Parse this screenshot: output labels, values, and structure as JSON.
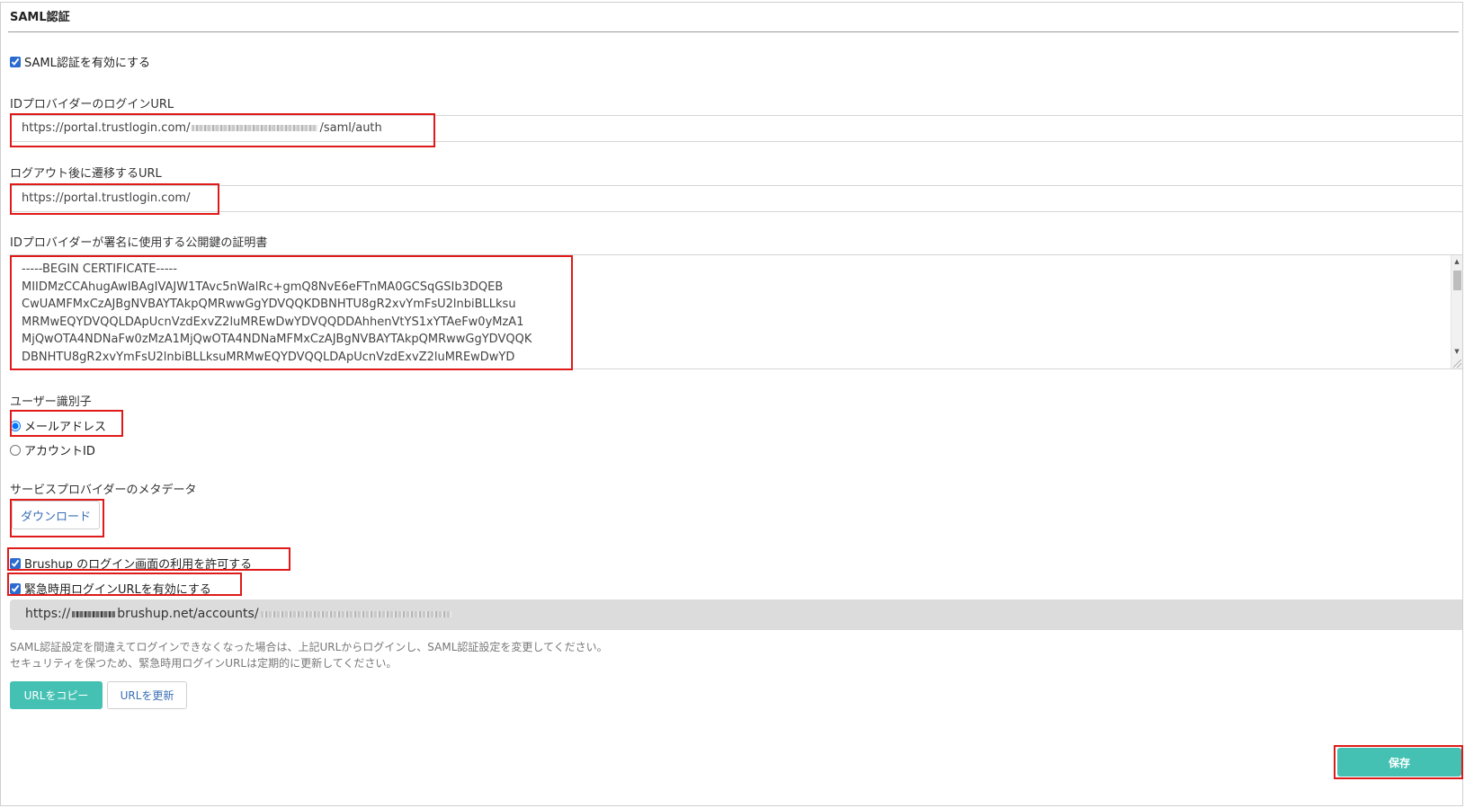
{
  "section": {
    "title": "SAML認証"
  },
  "enable_saml": {
    "label": "SAML認証を有効にする",
    "checked": true
  },
  "idp_login_url": {
    "label": "IDプロバイダーのログインURL",
    "value_prefix": "https://portal.trustlogin.com/",
    "value_suffix": "/saml/auth"
  },
  "logout_url": {
    "label": "ログアウト後に遷移するURL",
    "value": "https://portal.trustlogin.com/"
  },
  "certificate": {
    "label": "IDプロバイダーが署名に使用する公開鍵の証明書",
    "lines": [
      "-----BEGIN CERTIFICATE-----",
      "MIIDMzCCAhugAwIBAgIVAJW1TAvc5nWalRc+gmQ8NvE6eFTnMA0GCSqGSIb3DQEB",
      "CwUAMFMxCzAJBgNVBAYTAkpQMRwwGgYDVQQKDBNHTU8gR2xvYmFsU2lnbiBLLksu",
      "MRMwEQYDVQQLDApUcnVzdExvZ2luMREwDwYDVQQDDAhhenVtYS1xYTAeFw0yMzA1",
      "MjQwOTA4NDNaFw0zMzA1MjQwOTA4NDNaMFMxCzAJBgNVBAYTAkpQMRwwGgYDVQQK",
      "DBNHTU8gR2xvYmFsU2lnbiBLLksuMRMwEQYDVQQLDApUcnVzdExvZ2luMREwDwYD"
    ]
  },
  "user_identifier": {
    "label": "ユーザー識別子",
    "options": [
      {
        "label": "メールアドレス",
        "selected": true
      },
      {
        "label": "アカウントID",
        "selected": false
      }
    ]
  },
  "sp_metadata": {
    "label": "サービスプロバイダーのメタデータ",
    "download_label": "ダウンロード"
  },
  "allow_brushup_login": {
    "label": "Brushup のログイン画面の利用を許可する",
    "checked": true
  },
  "emergency_login": {
    "label": "緊急時用ログインURLを有効にする",
    "checked": true,
    "url_prefix": "https://",
    "url_middle": "brushup.net/accounts/"
  },
  "help": {
    "line1": "SAML認証設定を間違えてログインできなくなった場合は、上記URLからログインし、SAML認証設定を変更してください。",
    "line2": "セキュリティを保つため、緊急時用ログインURLは定期的に更新してください。"
  },
  "buttons": {
    "copy_url": "URLをコピー",
    "refresh_url": "URLを更新",
    "save": "保存"
  },
  "colors": {
    "accent": "#45c1b4",
    "link": "#3a6fb5",
    "highlight": "#e01a1a"
  }
}
